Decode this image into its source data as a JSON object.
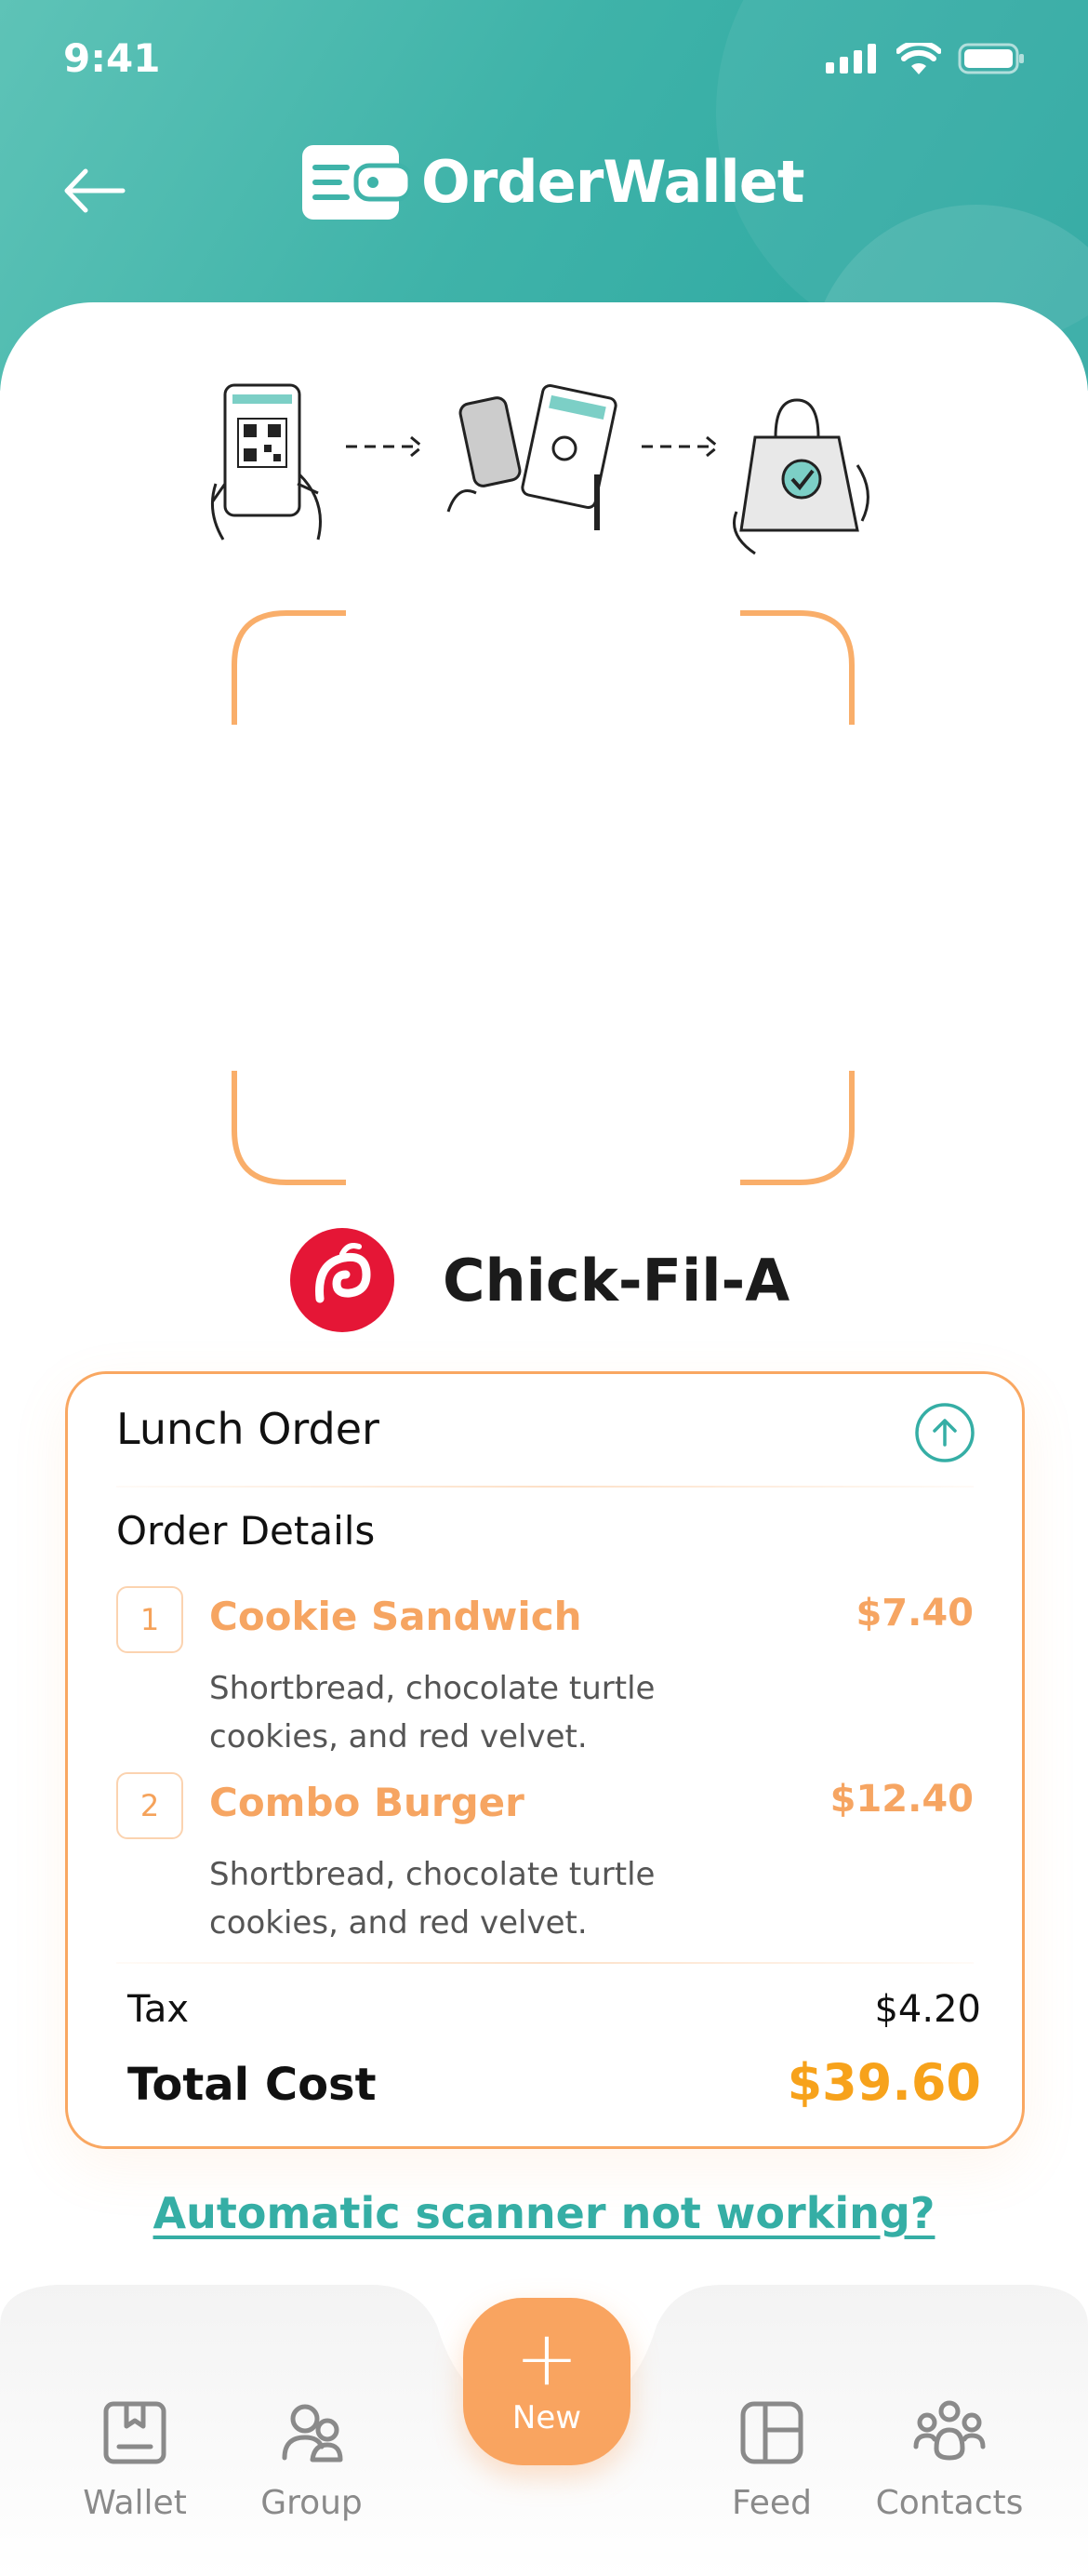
{
  "status_bar": {
    "time": "9:41"
  },
  "header": {
    "brand": "OrderWallet"
  },
  "restaurant": {
    "name": "Chick-Fil-A"
  },
  "order": {
    "title": "Lunch Order",
    "details_title": "Order Details",
    "items": [
      {
        "number": "1",
        "name": "Cookie Sandwich",
        "price": "$7.40",
        "description": "Shortbread, chocolate turtle cookies, and red velvet."
      },
      {
        "number": "2",
        "name": "Combo Burger",
        "price": "$12.40",
        "description": "Shortbread, chocolate turtle cookies, and red velvet."
      }
    ],
    "tax_label": "Tax",
    "tax_value": "$4.20",
    "total_label": "Total Cost",
    "total_value": "$39.60"
  },
  "help_link": "Automatic scanner not working?",
  "nav": {
    "items": [
      {
        "label": "Wallet",
        "icon": "wallet-icon"
      },
      {
        "label": "Group",
        "icon": "group-icon"
      },
      {
        "label": "Feed",
        "icon": "feed-icon"
      },
      {
        "label": "Contacts",
        "icon": "contacts-icon"
      }
    ],
    "fab_label": "New"
  },
  "colors": {
    "teal": "#3fb3a9",
    "orange": "#f9a460",
    "total": "#f7a21b"
  }
}
